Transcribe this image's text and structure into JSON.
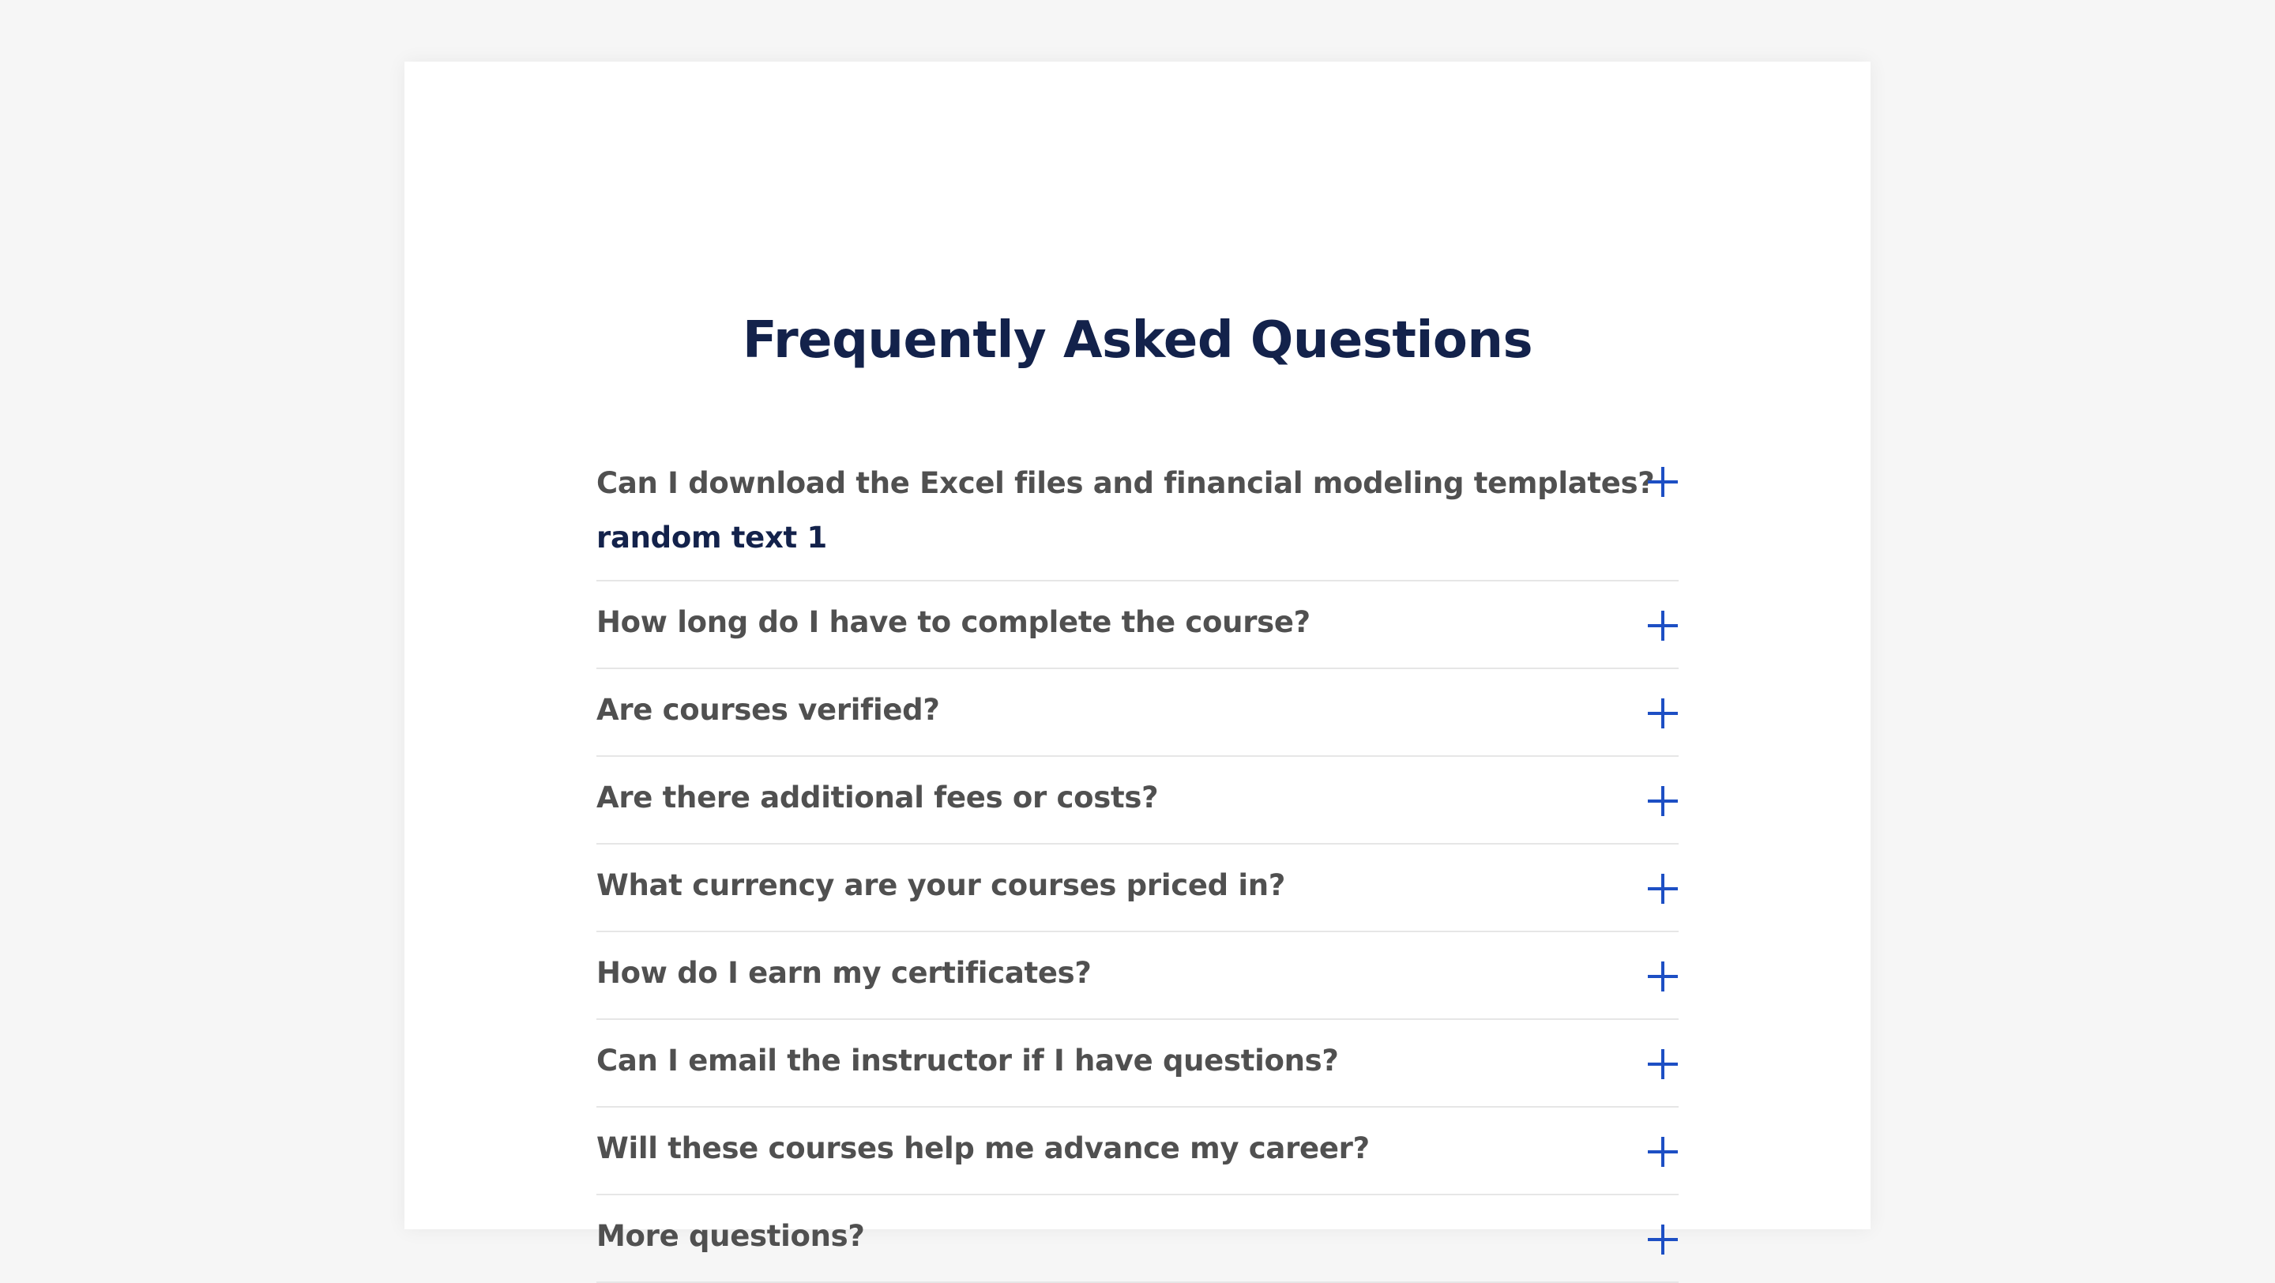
{
  "page": {
    "title": "Frequently Asked Questions"
  },
  "colors": {
    "background": "#f6f6f6",
    "card": "#ffffff",
    "title": "#13224b",
    "question": "#505050",
    "answer": "#13224b",
    "icon": "#1d4fc4",
    "divider": "#e6e6e6"
  },
  "faq": {
    "items": [
      {
        "question": "Can I download the Excel files and financial modeling templates?",
        "answer": "random text 1",
        "icon": "plus-icon"
      },
      {
        "question": "How long do I have to complete the course?",
        "icon": "plus-icon"
      },
      {
        "question": "Are courses verified?",
        "icon": "plus-icon"
      },
      {
        "question": "Are there additional fees or costs?",
        "icon": "plus-icon"
      },
      {
        "question": "What currency are your courses priced in?",
        "icon": "plus-icon"
      },
      {
        "question": "How do I earn my certificates?",
        "icon": "plus-icon"
      },
      {
        "question": "Can I email the instructor if I have questions?",
        "icon": "plus-icon"
      },
      {
        "question": "Will these courses help me advance my career?",
        "icon": "plus-icon"
      },
      {
        "question": "More questions?",
        "icon": "plus-icon"
      }
    ]
  }
}
